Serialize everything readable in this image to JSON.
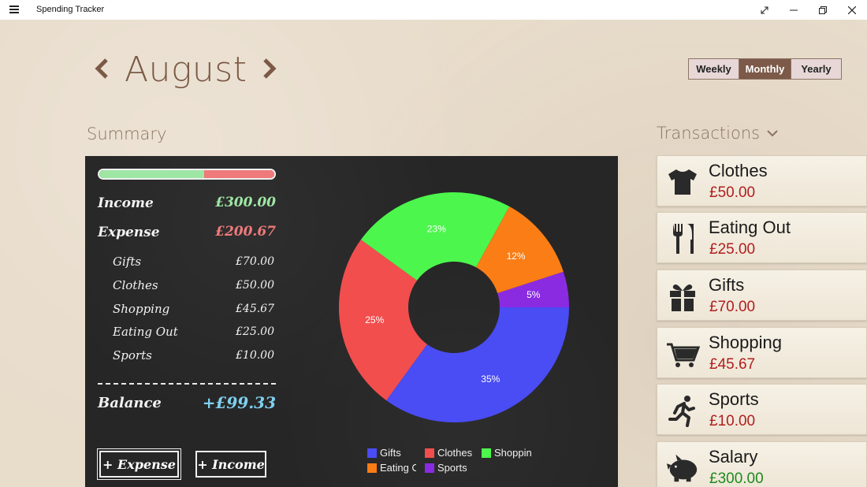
{
  "app": {
    "title": "Spending Tracker"
  },
  "header": {
    "month": "August",
    "prev": "‹",
    "next": "›"
  },
  "period_toggle": {
    "options": [
      "Weekly",
      "Monthly",
      "Yearly"
    ],
    "selected": "Monthly"
  },
  "summary": {
    "title": "Summary",
    "income_fraction": 0.6,
    "income": {
      "label": "Income",
      "value": "£300.00"
    },
    "expense": {
      "label": "Expense",
      "value": "£200.67"
    },
    "categories": [
      {
        "label": "Gifts",
        "value": "£70.00"
      },
      {
        "label": "Clothes",
        "value": "£50.00"
      },
      {
        "label": "Shopping",
        "value": "£45.67"
      },
      {
        "label": "Eating Out",
        "value": "£25.00"
      },
      {
        "label": "Sports",
        "value": "£10.00"
      }
    ],
    "balance": {
      "label": "Balance",
      "value": "+£99.33"
    },
    "add_expense": "+ Expense",
    "add_income": "+ Income"
  },
  "chart_data": {
    "type": "pie",
    "categories": [
      "Gifts",
      "Clothes",
      "Shopping",
      "Eating Out",
      "Sports"
    ],
    "values": [
      35,
      25,
      23,
      12,
      5
    ],
    "labels": [
      "35%",
      "25%",
      "23%",
      "12%",
      "5%"
    ],
    "colors": [
      "#4a4cf4",
      "#f24e4e",
      "#4cf64c",
      "#fa7d15",
      "#8a2be2"
    ],
    "legend": [
      "Gifts",
      "Clothes",
      "Shoppin",
      "Eating O",
      "Sports"
    ]
  },
  "transactions": {
    "title": "Transactions",
    "items": [
      {
        "name": "Clothes",
        "amount": "£50.00",
        "icon": "tshirt-icon",
        "color": "#b01e1e"
      },
      {
        "name": "Eating Out",
        "amount": "£25.00",
        "icon": "cutlery-icon",
        "color": "#b01e1e"
      },
      {
        "name": "Gifts",
        "amount": "£70.00",
        "icon": "gift-icon",
        "color": "#b01e1e"
      },
      {
        "name": "Shopping",
        "amount": "£45.67",
        "icon": "cart-icon",
        "color": "#b01e1e"
      },
      {
        "name": "Sports",
        "amount": "£10.00",
        "icon": "runner-icon",
        "color": "#b01e1e"
      },
      {
        "name": "Salary",
        "amount": "£300.00",
        "icon": "piggy-bank-icon",
        "color": "#1e8a1e"
      }
    ]
  },
  "colors": {
    "accent": "#7c5948",
    "income": "#9ee6a4",
    "expense": "#ef7a7a",
    "balance": "#7fd0f0"
  }
}
